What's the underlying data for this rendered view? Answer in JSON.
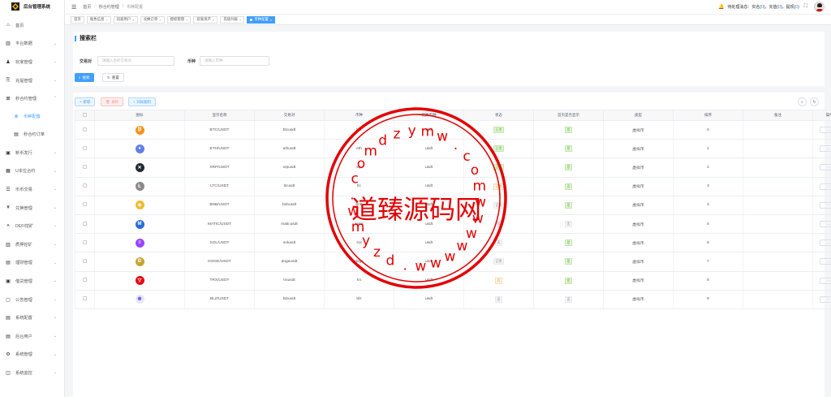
{
  "app": {
    "title": "后台管理系统"
  },
  "colors": {
    "primary": "#409eff",
    "watermark": "#e30000"
  },
  "sidebar": {
    "items": [
      {
        "icon": "dashboard-icon",
        "label": "首页"
      },
      {
        "icon": "chart-icon",
        "label": "平台数据"
      },
      {
        "icon": "user-icon",
        "label": "玩家管理"
      },
      {
        "icon": "recharge-icon",
        "label": "充提管理"
      },
      {
        "icon": "contract-icon",
        "label": "秒合约管理"
      },
      {
        "icon": "coin-config-icon",
        "label": "币种配置"
      },
      {
        "icon": "order-icon",
        "label": "秒合约订单"
      },
      {
        "icon": "newcoin-icon",
        "label": "新币发行"
      },
      {
        "icon": "ustd-contract-icon",
        "label": "U本位合约"
      },
      {
        "icon": "trade-icon",
        "label": "币币交易"
      },
      {
        "icon": "exchange-icon",
        "label": "兑换管理"
      },
      {
        "icon": "defi-icon",
        "label": "DEFI挖矿"
      },
      {
        "icon": "pledge-icon",
        "label": "质押挖矿"
      },
      {
        "icon": "finance-icon",
        "label": "理财管理"
      },
      {
        "icon": "loan-icon",
        "label": "借贷管理"
      },
      {
        "icon": "notice-icon",
        "label": "公告管理"
      },
      {
        "icon": "config-icon",
        "label": "系统配置"
      },
      {
        "icon": "admin-icon",
        "label": "后台用户"
      },
      {
        "icon": "system-icon",
        "label": "系统管理"
      },
      {
        "icon": "monitor-icon",
        "label": "系统监控"
      }
    ]
  },
  "header": {
    "breadcrumb": [
      "首页",
      "秒合约管理",
      "币种配置"
    ],
    "notice_prefix": "待处理消息：实名(",
    "notice_shiming": "0",
    "notice_mid1": ")，充值(",
    "notice_chongzhi": "0",
    "notice_mid2": ")，提现(",
    "notice_tixian": "0",
    "notice_suffix": ")"
  },
  "tabs": [
    "首页",
    "角色信息",
    "玩家用户",
    "兑换订单",
    "授权管理",
    "玩家资产",
    "充值列表",
    "币种配置"
  ],
  "search": {
    "title": "搜索栏",
    "pair_label": "交易对",
    "pair_placeholder": "请输入合约交易对",
    "coin_label": "币种",
    "coin_placeholder": "请输入币种",
    "search_btn": "搜索",
    "reset_btn": "重置"
  },
  "toolbar": {
    "add": "新增",
    "delete": "删除",
    "sync": "同局复制"
  },
  "table": {
    "headers": [
      "图标",
      "显示名称",
      "交易对",
      "币种",
      "结算币种",
      "状态",
      "首页是否显示",
      "类型",
      "排序",
      "备注",
      "操作"
    ],
    "rows": [
      {
        "icon": "btc-icon",
        "color": "#f7931a",
        "glyph": "₿",
        "name": "BTC/USDT",
        "pair": "btcusdt",
        "coin": "btc",
        "settle": "usdt",
        "status": "正常",
        "status_type": "yes",
        "home": "是",
        "home_type": "yes",
        "type": "虚拟币",
        "sort": "0",
        "remark": "",
        "ops": "···"
      },
      {
        "icon": "eth-icon",
        "color": "#627eea",
        "glyph": "♦",
        "name": "ETH/USDT",
        "pair": "ethusdt",
        "coin": "eth",
        "settle": "usdt",
        "status": "正常",
        "status_type": "yes",
        "home": "是",
        "home_type": "yes",
        "type": "虚拟币",
        "sort": "1",
        "remark": "",
        "ops": "···"
      },
      {
        "icon": "xrp-icon",
        "color": "#23292f",
        "glyph": "✕",
        "name": "XRP/USDT",
        "pair": "xrpusdt",
        "coin": "xrp",
        "settle": "usdt",
        "status": "正常",
        "status_type": "yes",
        "home": "是",
        "home_type": "yes",
        "type": "虚拟币",
        "sort": "2",
        "remark": "",
        "ops": "···"
      },
      {
        "icon": "ltc-icon",
        "color": "#8a8a8a",
        "glyph": "Ł",
        "name": "LTC/USDT",
        "pair": "ltcusdt",
        "coin": "ltc",
        "settle": "usdt",
        "status": "正常",
        "status_type": "warn",
        "home": "否",
        "home_type": "yes",
        "type": "虚拟币",
        "sort": "3",
        "remark": "",
        "ops": "···"
      },
      {
        "icon": "bnb-icon",
        "color": "#f3ba2f",
        "glyph": "◆",
        "name": "BNB/USDT",
        "pair": "bnbusdt",
        "coin": "bnb",
        "settle": "usdt",
        "status": "正常",
        "status_type": "no",
        "home": "是",
        "home_type": "yes",
        "type": "虚拟币",
        "sort": "4",
        "remark": "",
        "ops": "···"
      },
      {
        "icon": "matic-icon",
        "color": "#2a6cd8",
        "glyph": "M",
        "name": "MATIC/USDT",
        "pair": "maticusdt",
        "coin": "matic",
        "settle": "usdt",
        "status": "否",
        "status_type": "no",
        "home": "否",
        "home_type": "no",
        "type": "虚拟币",
        "sort": "5",
        "remark": "",
        "ops": "···"
      },
      {
        "icon": "sol-icon",
        "color": "#9945ff",
        "glyph": "≡",
        "name": "SOL/USDT",
        "pair": "solusdt",
        "coin": "sol",
        "settle": "usdt",
        "status": "否",
        "status_type": "no",
        "home": "是",
        "home_type": "yes",
        "type": "虚拟币",
        "sort": "6",
        "remark": "",
        "ops": "···"
      },
      {
        "icon": "doge-icon",
        "color": "#c2a633",
        "glyph": "Ð",
        "name": "DOGE/USDT",
        "pair": "dogeusdt",
        "coin": "doge",
        "settle": "usdt",
        "status": "正常",
        "status_type": "no",
        "home": "是",
        "home_type": "yes",
        "type": "虚拟币",
        "sort": "7",
        "remark": "",
        "ops": "···"
      },
      {
        "icon": "trx-icon",
        "color": "#e50915",
        "glyph": "▽",
        "name": "TRX/USDT",
        "pair": "trxusdt",
        "coin": "trx",
        "settle": "usdt",
        "status": "否",
        "status_type": "warn",
        "home": "是",
        "home_type": "yes",
        "type": "虚拟币",
        "sort": "8",
        "remark": "",
        "ops": "···"
      },
      {
        "icon": "blz-icon",
        "color": "#e8e8f8",
        "glyph": "✺",
        "name": "BLZ/USDT",
        "pair": "blzusdt",
        "coin": "blz",
        "settle": "usdt",
        "status": "否",
        "status_type": "no",
        "home": "否",
        "home_type": "no",
        "type": "虚拟币",
        "sort": "9",
        "remark": "",
        "ops": "···"
      }
    ]
  },
  "watermark": {
    "center_text": "道臻源码网",
    "ring_text": [
      "d",
      "z",
      "y",
      "m",
      "w",
      ".",
      "c",
      "o",
      "m",
      "w",
      "w",
      "w",
      "w",
      "w",
      "w",
      "w",
      ".",
      "d",
      "z",
      "y",
      "m",
      "w",
      ".",
      "c",
      "o",
      "m"
    ]
  }
}
